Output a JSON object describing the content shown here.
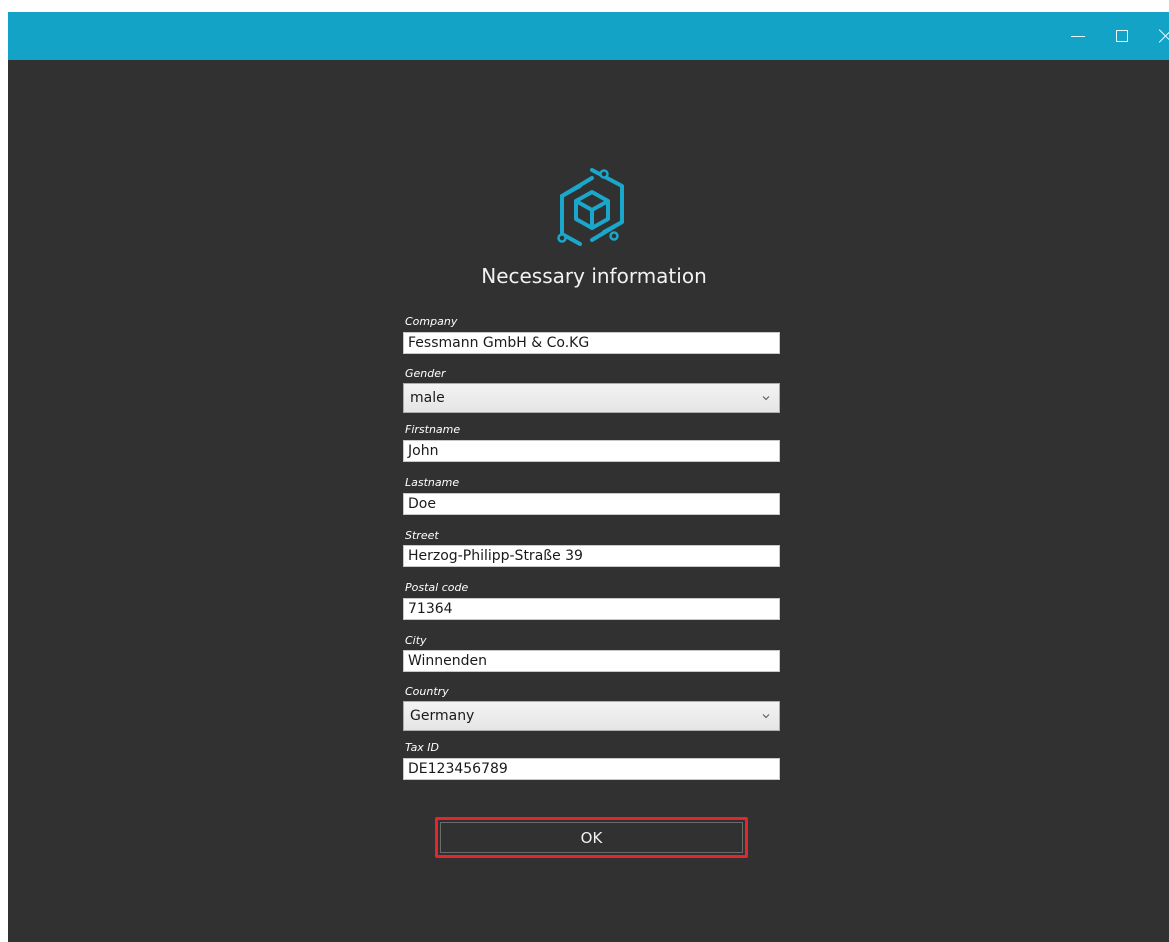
{
  "window": {
    "controls": {
      "minimize": "minimize-icon",
      "maximize": "maximize-icon",
      "close": "close-icon"
    },
    "titlebar_color": "#12a3c6",
    "background_color": "#313131"
  },
  "logo": {
    "icon": "hexagon-logo-icon",
    "color": "#1aa7cc"
  },
  "heading": "Necessary information",
  "form": {
    "company": {
      "label": "Company",
      "value": "Fessmann GmbH & Co.KG"
    },
    "gender": {
      "label": "Gender",
      "value": "male"
    },
    "firstname": {
      "label": "Firstname",
      "value": "John"
    },
    "lastname": {
      "label": "Lastname",
      "value": "Doe"
    },
    "street": {
      "label": "Street",
      "value": "Herzog-Philipp-Straße 39"
    },
    "postal_code": {
      "label": "Postal code",
      "value": "71364"
    },
    "city": {
      "label": "City",
      "value": "Winnenden"
    },
    "country": {
      "label": "Country",
      "value": "Germany"
    },
    "tax_id": {
      "label": "Tax ID",
      "value": "DE123456789"
    }
  },
  "ok_button": {
    "label": "OK",
    "highlight_color": "#e3262b"
  }
}
